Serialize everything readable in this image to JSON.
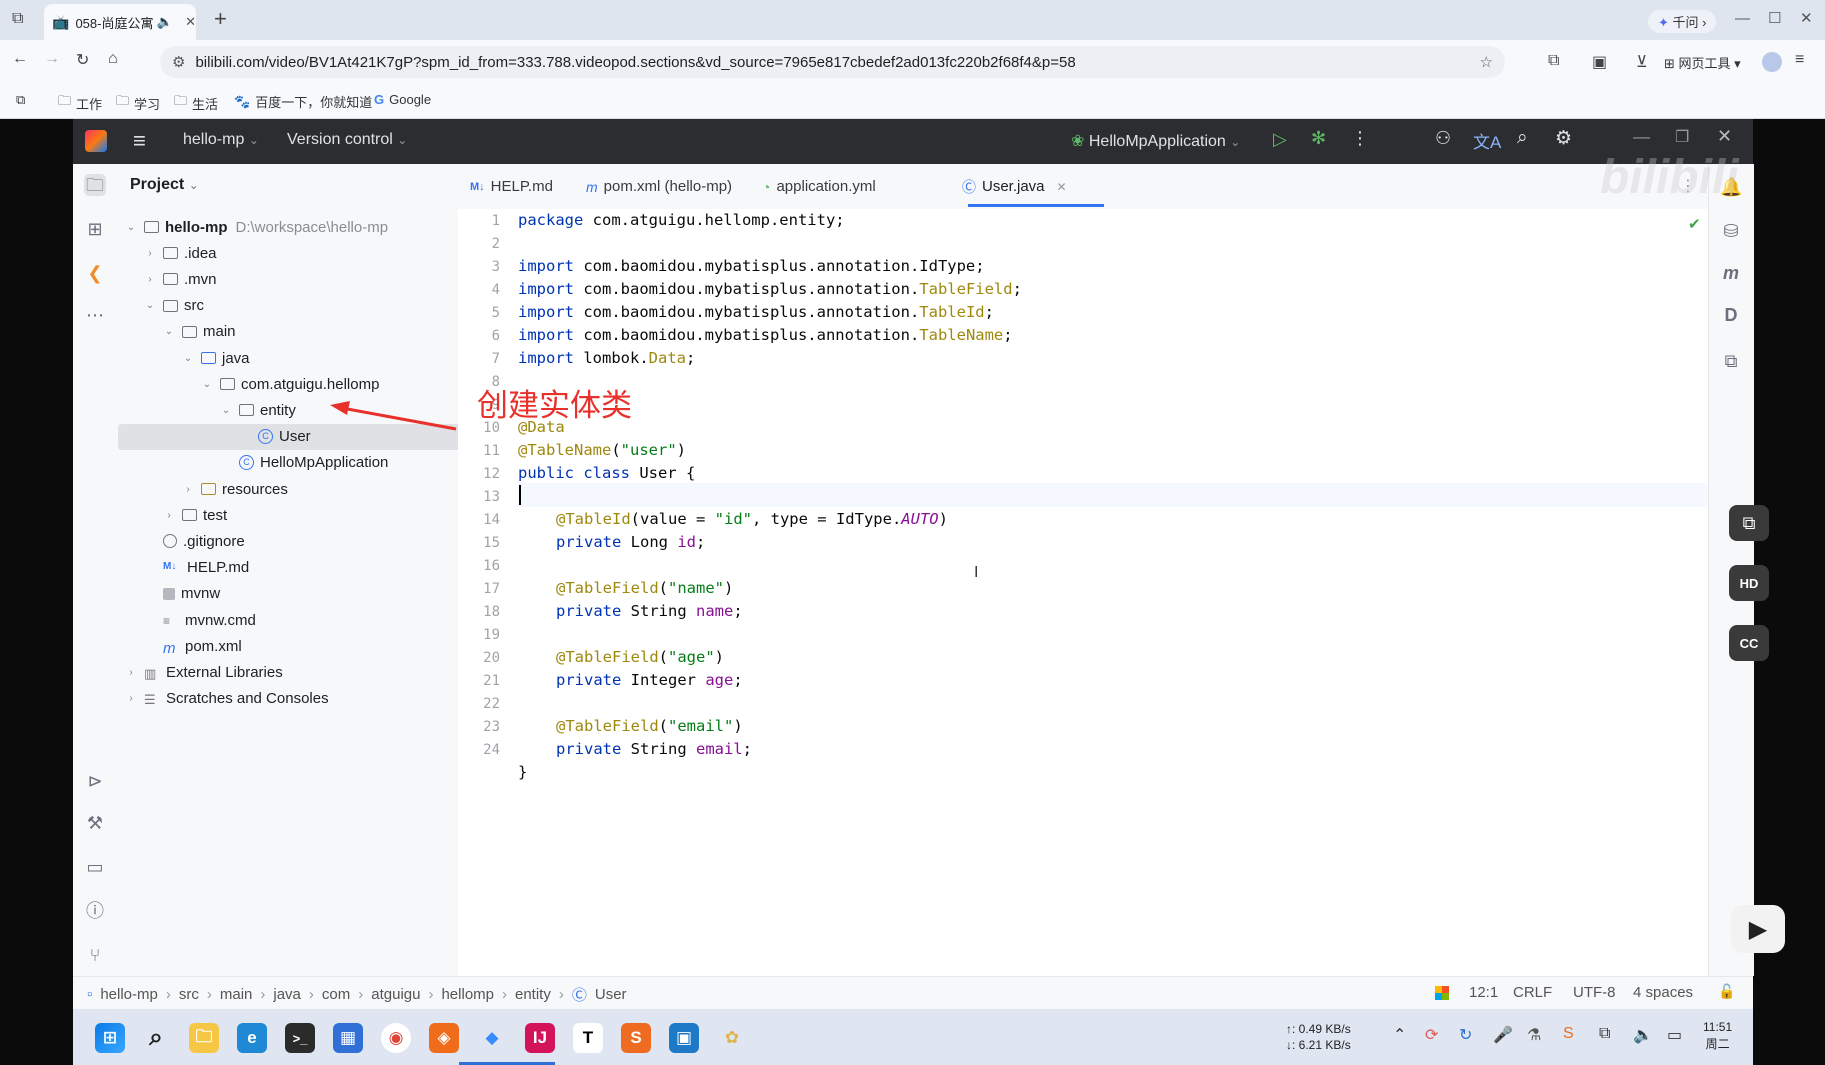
{
  "browser": {
    "tab_title": "058-尚庭公寓",
    "new_tab": "+",
    "ai_button": "千问 ›",
    "url": "bilibili.com/video/BV1At421K7gP?spm_id_from=333.788.videopod.sections&vd_source=7965e817cbedef2ad013fc220b2f68f4&p=58",
    "tools_label": "网页工具",
    "bookmarks": [
      "工作",
      "学习",
      "生活",
      "百度一下，你就知道",
      "Google"
    ]
  },
  "ide": {
    "project_name": "hello-mp",
    "vcs": "Version control",
    "run_config": "HelloMpApplication",
    "panel_title": "Project",
    "tree": [
      {
        "label": "hello-mp",
        "path": "D:\\workspace\\hello-mp",
        "depth": 0,
        "arrow": "open",
        "type": "module"
      },
      {
        "label": ".idea",
        "depth": 1,
        "arrow": "closed",
        "type": "folder"
      },
      {
        "label": ".mvn",
        "depth": 1,
        "arrow": "closed",
        "type": "folder"
      },
      {
        "label": "src",
        "depth": 1,
        "arrow": "open",
        "type": "folder"
      },
      {
        "label": "main",
        "depth": 2,
        "arrow": "open",
        "type": "folder"
      },
      {
        "label": "java",
        "depth": 3,
        "arrow": "open",
        "type": "srcfolder"
      },
      {
        "label": "com.atguigu.hellomp",
        "depth": 4,
        "arrow": "open",
        "type": "package"
      },
      {
        "label": "entity",
        "depth": 5,
        "arrow": "open",
        "type": "package"
      },
      {
        "label": "User",
        "depth": 6,
        "arrow": "none",
        "type": "class",
        "selected": true
      },
      {
        "label": "HelloMpApplication",
        "depth": 5,
        "arrow": "none",
        "type": "springclass"
      },
      {
        "label": "resources",
        "depth": 3,
        "arrow": "closed",
        "type": "resfolder"
      },
      {
        "label": "test",
        "depth": 2,
        "arrow": "closed",
        "type": "folder"
      },
      {
        "label": ".gitignore",
        "depth": 1,
        "arrow": "none",
        "type": "ignore"
      },
      {
        "label": "HELP.md",
        "depth": 1,
        "arrow": "none",
        "type": "md"
      },
      {
        "label": "mvnw",
        "depth": 1,
        "arrow": "none",
        "type": "exec"
      },
      {
        "label": "mvnw.cmd",
        "depth": 1,
        "arrow": "none",
        "type": "text"
      },
      {
        "label": "pom.xml",
        "depth": 1,
        "arrow": "none",
        "type": "maven"
      },
      {
        "label": "External Libraries",
        "depth": 0,
        "arrow": "closed",
        "type": "libs"
      },
      {
        "label": "Scratches and Consoles",
        "depth": 0,
        "arrow": "closed",
        "type": "scratch"
      }
    ],
    "editor_tabs": [
      {
        "label": "HELP.md",
        "icon": "M↓"
      },
      {
        "label": "pom.xml (hello-mp)",
        "icon": "m"
      },
      {
        "label": "application.yml",
        "icon": "◔"
      },
      {
        "label": "User.java",
        "icon": "Ⓒ",
        "active": true
      }
    ],
    "annotation_note": "创建实体类",
    "line_numbers": [
      "1",
      "2",
      "3",
      "4",
      "5",
      "6",
      "7",
      "8",
      "9",
      "10",
      "11",
      "12",
      "13",
      "14",
      "15",
      "16",
      "17",
      "18",
      "19",
      "20",
      "21",
      "22",
      "23",
      "24"
    ],
    "breadcrumb": [
      "hello-mp",
      "src",
      "main",
      "java",
      "com",
      "atguigu",
      "hellomp",
      "entity",
      "User"
    ],
    "status": {
      "position": "12:1",
      "line_sep": "CRLF",
      "encoding": "UTF-8",
      "indent": "4 spaces"
    }
  },
  "code": {
    "l1_kw": "package",
    "l1_rest": " com.atguigu.hellomp.entity;",
    "l3_kw": "import",
    "l3_rest": " com.baomidou.mybatisplus.annotation.IdType;",
    "l4_kw": "import",
    "l4_pre": " com.baomidou.mybatisplus.annotation.",
    "l4_cls": "TableField",
    "l4_end": ";",
    "l5_kw": "import",
    "l5_pre": " com.baomidou.mybatisplus.annotation.",
    "l5_cls": "TableId",
    "l5_end": ";",
    "l6_kw": "import",
    "l6_pre": " com.baomidou.mybatisplus.annotation.",
    "l6_cls": "TableName",
    "l6_end": ";",
    "l7_kw": "import",
    "l7_pre": " lombok.",
    "l7_cls": "Data",
    "l7_end": ";",
    "l9_ann": "@Data",
    "l10_ann": "@TableName",
    "l10_p1": "(",
    "l10_str": "\"user\"",
    "l10_p2": ")",
    "l11_kw": "public class",
    "l11_rest": " User {",
    "l13_ann": "@TableId",
    "l13_a": "(value = ",
    "l13_str": "\"id\"",
    "l13_b": ", type = IdType.",
    "l13_it": "AUTO",
    "l13_c": ")",
    "l14_kw": "private",
    "l14_type": " Long ",
    "l14_fld": "id",
    "l14_end": ";",
    "l16_ann": "@TableField",
    "l16_p1": "(",
    "l16_str": "\"name\"",
    "l16_p2": ")",
    "l17_kw": "private",
    "l17_type": " String ",
    "l17_fld": "name",
    "l17_end": ";",
    "l19_ann": "@TableField",
    "l19_p1": "(",
    "l19_str": "\"age\"",
    "l19_p2": ")",
    "l20_kw": "private",
    "l20_type": " Integer ",
    "l20_fld": "age",
    "l20_end": ";",
    "l22_ann": "@TableField",
    "l22_p1": "(",
    "l22_str": "\"email\"",
    "l22_p2": ")",
    "l23_kw": "private",
    "l23_type": " String ",
    "l23_fld": "email",
    "l23_end": ";",
    "l24": "}"
  },
  "taskbar": {
    "net_up": "↑: 0.49 KB/s",
    "net_down": "↓: 6.21 KB/s",
    "time": "11:51",
    "day": "周二"
  },
  "colors": {
    "accent": "#3574f0",
    "annotation_red": "#e8312b"
  }
}
